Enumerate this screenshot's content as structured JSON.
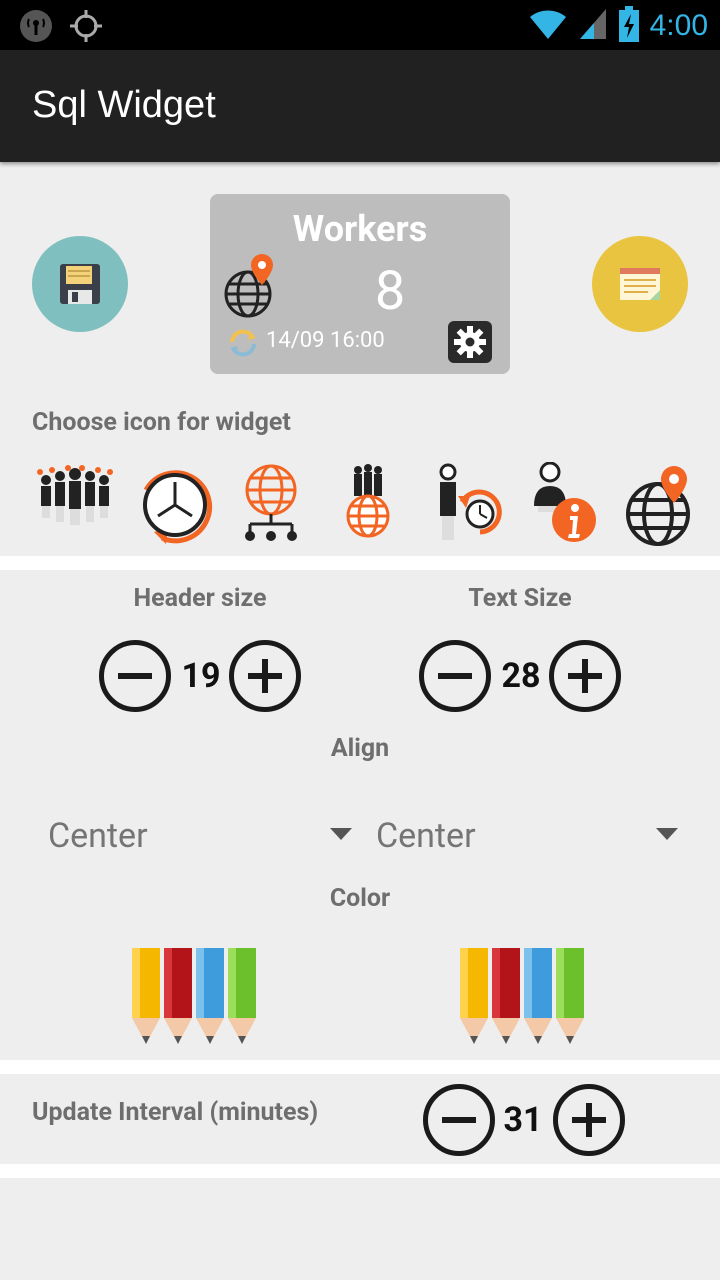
{
  "status_bar": {
    "time": "4:00",
    "icons": [
      "hotspot-icon",
      "gps-icon",
      "wifi-icon",
      "signal-icon",
      "battery-charging-icon"
    ]
  },
  "app_bar": {
    "title": "Sql Widget"
  },
  "widget_preview": {
    "title": "Workers",
    "value": "8",
    "updated": "14/09 16:00"
  },
  "icon_chooser": {
    "label": "Choose icon for widget",
    "icons": [
      "people-group-icon",
      "clock-refresh-icon",
      "network-globe-icon",
      "people-globe-icon",
      "person-time-icon",
      "person-info-icon",
      "globe-location-icon"
    ]
  },
  "sizes": {
    "header_label": "Header size",
    "header_value": "19",
    "text_label": "Text Size",
    "text_value": "28"
  },
  "align": {
    "label": "Align",
    "header_align": "Center",
    "text_align": "Center"
  },
  "color": {
    "label": "Color"
  },
  "update_interval": {
    "label": "Update Interval (minutes)",
    "value": "31"
  },
  "colors": {
    "accent": "#33b5e5",
    "save_button": "#7fbfbf",
    "notes_button": "#e9c440",
    "orange": "#f26522"
  }
}
